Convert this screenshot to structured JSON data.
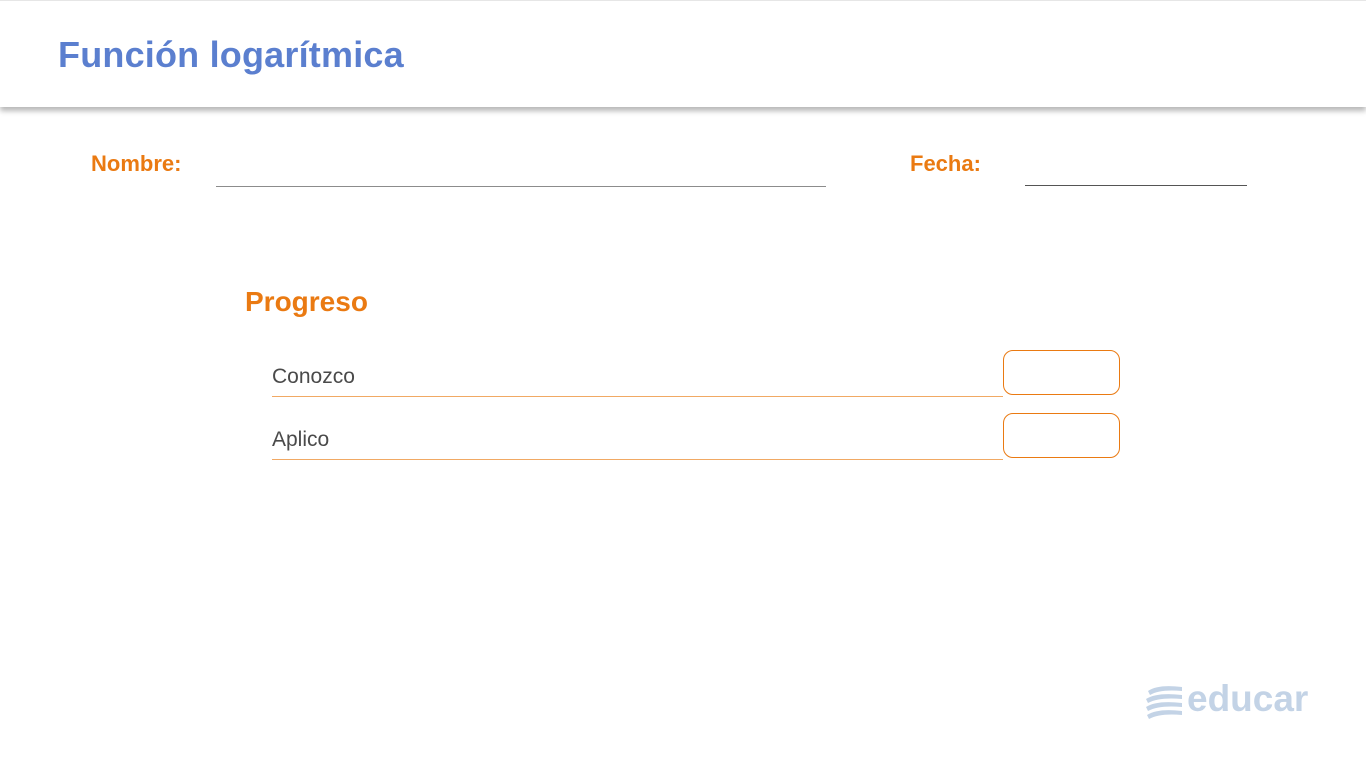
{
  "header": {
    "title": "Función logarítmica"
  },
  "form": {
    "name_label": "Nombre:",
    "date_label": "Fecha:"
  },
  "progress": {
    "title": "Progreso",
    "rows": [
      {
        "label": "Conozco"
      },
      {
        "label": "Aplico"
      }
    ]
  },
  "brand": {
    "logo_text": "educar",
    "logo_icon": "educar-logo-icon"
  },
  "colors": {
    "title_blue": "#5b7fcf",
    "accent_orange": "#ea7a12",
    "logo_blue": "#c3d3e6"
  }
}
